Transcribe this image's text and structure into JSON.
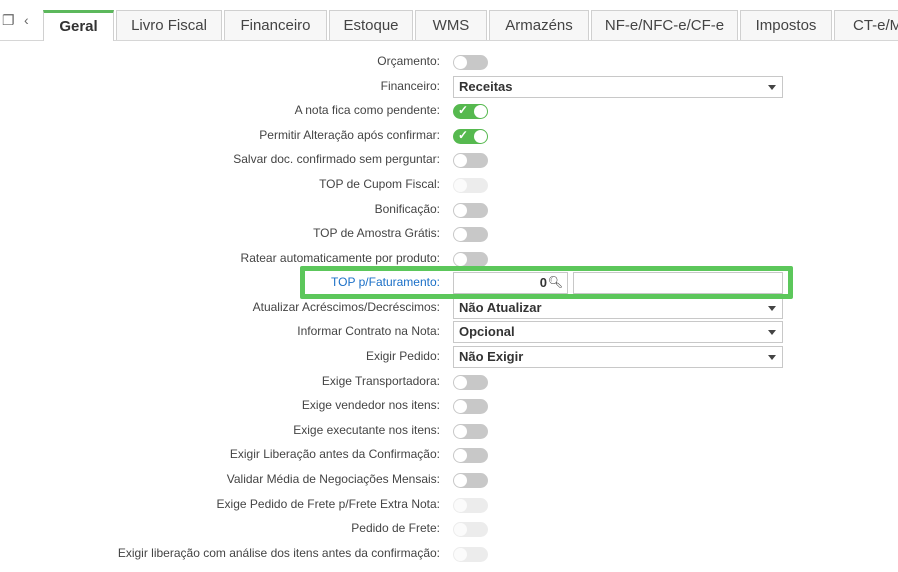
{
  "tabs": [
    {
      "label": "Geral",
      "active": true
    },
    {
      "label": "Livro Fiscal",
      "active": false
    },
    {
      "label": "Financeiro",
      "active": false
    },
    {
      "label": "Estoque",
      "active": false
    },
    {
      "label": "WMS",
      "active": false
    },
    {
      "label": "Armazéns",
      "active": false
    },
    {
      "label": "NF-e/NFC-e/CF-e",
      "active": false
    },
    {
      "label": "Impostos",
      "active": false
    },
    {
      "label": "CT-e/M",
      "active": false
    }
  ],
  "fields": {
    "orcamento": {
      "label": "Orçamento:",
      "state": "off"
    },
    "financeiro": {
      "label": "Financeiro:",
      "value": "Receitas"
    },
    "nota_pendente": {
      "label": "A nota fica como pendente:",
      "state": "on"
    },
    "permitir_alteracao": {
      "label": "Permitir Alteração após confirmar:",
      "state": "on"
    },
    "salvar_doc": {
      "label": "Salvar doc. confirmado sem perguntar:",
      "state": "off"
    },
    "top_cupom": {
      "label": "TOP de Cupom Fiscal:",
      "state": "disabled"
    },
    "bonificacao": {
      "label": "Bonificação:",
      "state": "off"
    },
    "top_amostra": {
      "label": "TOP de Amostra Grátis:",
      "state": "off"
    },
    "ratear": {
      "label": "Ratear automaticamente por produto:",
      "state": "off"
    },
    "top_faturamento": {
      "label": "TOP p/Faturamento:",
      "value": "0",
      "description": ""
    },
    "atualizar_acrescimos": {
      "label": "Atualizar Acréscimos/Decréscimos:",
      "value": "Não Atualizar"
    },
    "informar_contrato": {
      "label": "Informar Contrato na Nota:",
      "value": "Opcional"
    },
    "exigir_pedido": {
      "label": "Exigir Pedido:",
      "value": "Não Exigir"
    },
    "exige_transportadora": {
      "label": "Exige Transportadora:",
      "state": "off"
    },
    "exige_vendedor": {
      "label": "Exige vendedor nos itens:",
      "state": "off"
    },
    "exige_executante": {
      "label": "Exige executante nos itens:",
      "state": "off"
    },
    "exigir_liberacao": {
      "label": "Exigir Liberação antes da Confirmação:",
      "state": "off"
    },
    "validar_media": {
      "label": "Validar Média de Negociações Mensais:",
      "state": "off"
    },
    "exige_pedido_frete": {
      "label": "Exige Pedido de Frete p/Frete Extra Nota:",
      "state": "disabled"
    },
    "pedido_frete": {
      "label": "Pedido de Frete:",
      "state": "disabled"
    },
    "exigir_liberacao_itens": {
      "label": "Exigir liberação com análise dos itens antes da confirmação:",
      "state": "disabled"
    }
  },
  "colors": {
    "accent": "#5cb85c",
    "highlight": "#5cc75b",
    "link": "#1a6fc7",
    "toggle_on": "#56b94f"
  }
}
